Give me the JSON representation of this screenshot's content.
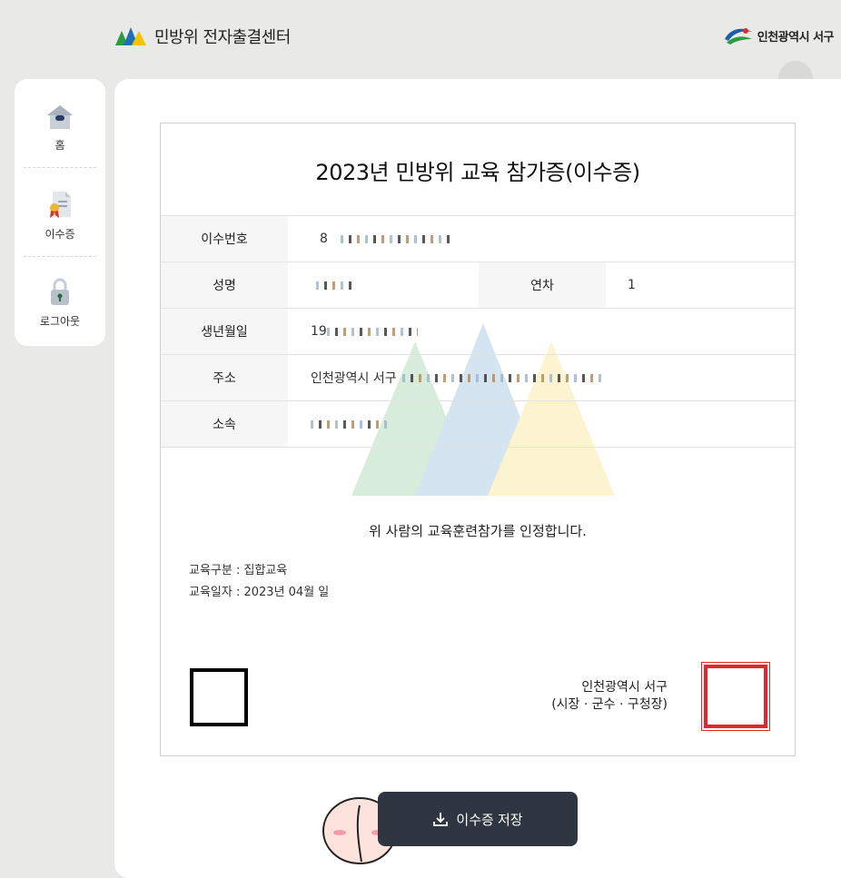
{
  "header": {
    "site_title": "민방위 전자출결센터",
    "brand": "인천광역시 서구",
    "logo_icon": "mountains-logo-icon",
    "brand_icon": "incheon-seogu-logo-icon"
  },
  "sidebar": {
    "items": [
      {
        "label": "홈",
        "icon": "home-icon"
      },
      {
        "label": "이수증",
        "icon": "certificate-icon"
      },
      {
        "label": "로그아웃",
        "icon": "lock-icon"
      }
    ]
  },
  "certificate": {
    "title": "2023년 민방위 교육 참가증(이수증)",
    "fields": {
      "cert_no_label": "이수번호",
      "cert_no_value": "8",
      "name_label": "성명",
      "year_label": "연차",
      "year_value": "1",
      "birth_label": "생년월일",
      "birth_value": "19",
      "address_label": "주소",
      "address_value": "인천광역시 서구",
      "affiliation_label": "소속"
    },
    "statement": "위 사람의 교육훈련참가를 인정합니다.",
    "edu_type": "교육구분 : 집합교육",
    "edu_date": "교육일자 : 2023년 04월      일",
    "issuer_line1": "인천광역시 서구",
    "issuer_line2": "(시장 · 군수 · 구청장)"
  },
  "actions": {
    "save_label": "이수증 저장",
    "save_icon": "download-icon"
  },
  "colors": {
    "background": "#e9eae8",
    "button": "#2f3641",
    "stamp": "#e2262c"
  }
}
